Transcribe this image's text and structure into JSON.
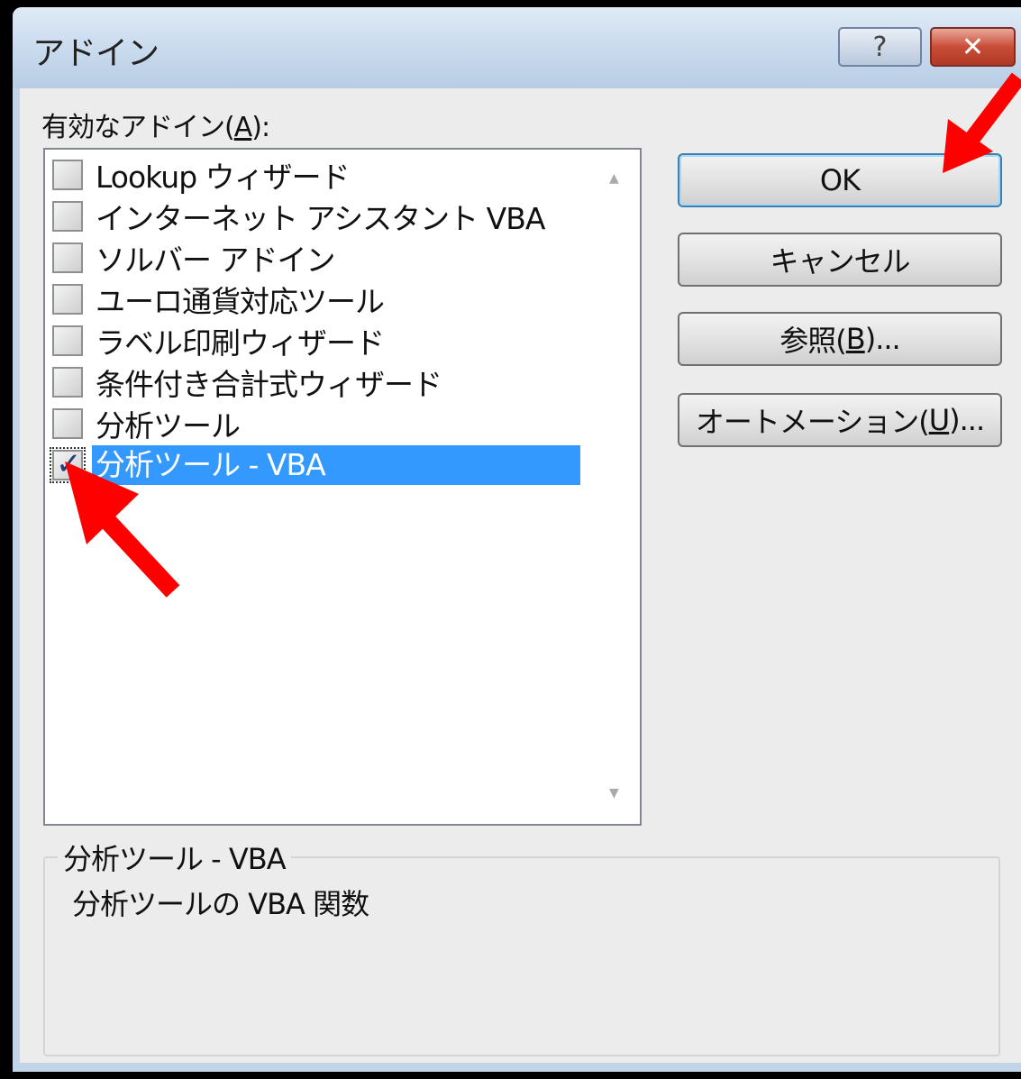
{
  "window": {
    "title": "アドイン",
    "help_glyph": "?",
    "close_glyph": "✕"
  },
  "list": {
    "label_prefix": "有効なアドイン(",
    "label_accel": "A",
    "label_suffix": "):",
    "items": [
      {
        "label": "Lookup ウィザード",
        "checked": false
      },
      {
        "label": "インターネット アシスタント VBA",
        "checked": false
      },
      {
        "label": "ソルバー アドイン",
        "checked": false
      },
      {
        "label": "ユーロ通貨対応ツール",
        "checked": false
      },
      {
        "label": "ラベル印刷ウィザード",
        "checked": false
      },
      {
        "label": "条件付き合計式ウィザード",
        "checked": false
      },
      {
        "label": "分析ツール",
        "checked": false
      },
      {
        "label": "分析ツール - VBA",
        "checked": true,
        "selected": true
      }
    ],
    "check_glyph": "✓"
  },
  "buttons": {
    "ok": "OK",
    "cancel": "キャンセル",
    "browse_prefix": "参照(",
    "browse_accel": "B",
    "browse_suffix": ")...",
    "automation_prefix": "オートメーション(",
    "automation_accel": "U",
    "automation_suffix": ")..."
  },
  "details": {
    "title": "分析ツール - VBA",
    "description": "分析ツールの VBA 関数"
  },
  "annotations": {
    "arrow_color": "#ff0000"
  }
}
